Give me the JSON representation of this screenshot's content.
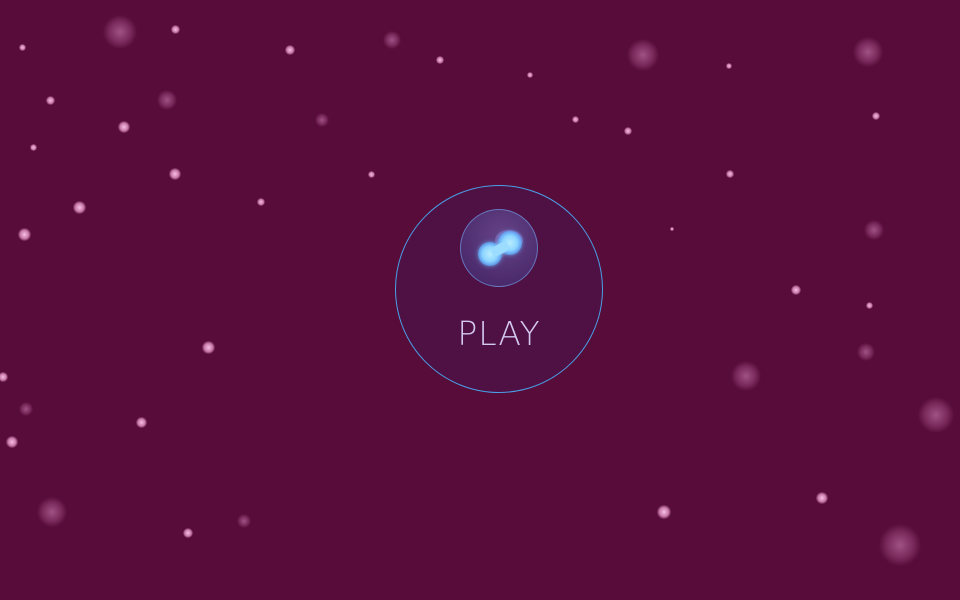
{
  "game": {
    "play_label": "PLAY"
  },
  "colors": {
    "background": "#570c39",
    "button_ring": "#4a9fe6",
    "button_text": "#d3c8f0",
    "orb_glow": "#8fd6ff"
  },
  "icons": {
    "logo": "twin-blob-orb-icon"
  }
}
